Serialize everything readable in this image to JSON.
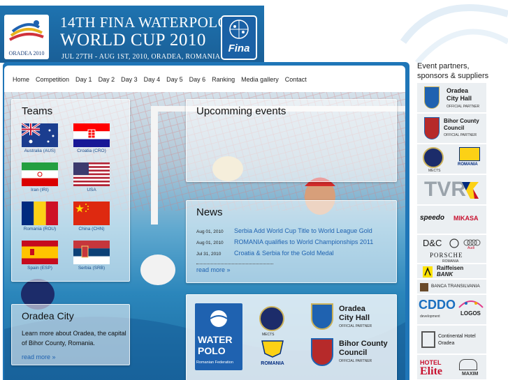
{
  "header": {
    "title_line1": "14TH FINA WATERPOLO",
    "title_line2": "WORLD CUP 2010",
    "title_line3": "JUL 27TH - AUG 1ST, 2010, ORADEA, ROMANIA",
    "host_logo_text": "ORADEA 2010",
    "fina_logo_text": "Fina"
  },
  "nav": {
    "items": [
      "Home",
      "Competition",
      "Day 1",
      "Day 2",
      "Day 3",
      "Day 4",
      "Day 5",
      "Day 6",
      "Ranking",
      "Media gallery",
      "Contact"
    ]
  },
  "teams": {
    "title": "Teams",
    "list": [
      {
        "label": "Australia (AUS)",
        "flag": "australia-flag"
      },
      {
        "label": "Croatia (CRO)",
        "flag": "croatia-flag"
      },
      {
        "label": "Iran (IRI)",
        "flag": "iran-flag"
      },
      {
        "label": "USA",
        "flag": "usa-flag"
      },
      {
        "label": "Romania (ROU)",
        "flag": "romania-flag"
      },
      {
        "label": "China (CHN)",
        "flag": "china-flag"
      },
      {
        "label": "Spain (ESP)",
        "flag": "spain-flag"
      },
      {
        "label": "Serbia (SRB)",
        "flag": "serbia-flag"
      }
    ]
  },
  "events": {
    "title": "Upcomming events"
  },
  "news": {
    "title": "News",
    "items": [
      {
        "date": "Aug 01, 2010",
        "title": "Serbia Add World Cup Title to World League Gold"
      },
      {
        "date": "Aug 01, 2010",
        "title": "ROMANIA qualifies to World Championships 2011"
      },
      {
        "date": "Jul 31, 2010",
        "title": "Croatia & Serbia for the Gold Medal"
      }
    ],
    "more": "read more »"
  },
  "oradea": {
    "title": "Oradea City",
    "text": "Learn more about Oradea, the capital of Bihor County, Romania.",
    "more": "read more »"
  },
  "partners_box": {
    "wp_line1": "WATER",
    "wp_line2": "POLO",
    "wp_sub": "Romanian Federation",
    "mects": "MECTS",
    "romania": "ROMANIA",
    "city_hall_line1": "Oradea",
    "city_hall_line2": "City Hall",
    "city_hall_sub": "OFFICIAL PARTNER",
    "county_line1": "Bihor County",
    "county_line2": "Council",
    "county_sub": "OFFICIAL PARTNER"
  },
  "sidebar": {
    "heading_line1": "Event partners,",
    "heading_line2": "sponsors & suppliers",
    "city_hall_line1": "Oradea",
    "city_hall_line2": "City Hall",
    "city_hall_sub": "OFFICIAL PARTNER",
    "county_line1": "Bihor County",
    "county_line2": "Council",
    "county_sub": "OFFICIAL PARTNER",
    "mects": "MECTS",
    "romania": "ROMANIA",
    "tvr": "TVR",
    "speedo": "speedo",
    "mikasa": "MIKASA",
    "dc": "D&C",
    "audi": "Audi",
    "porsche": "PORSCHE",
    "porsche_sub": "ROMANIA",
    "raiffeisen_line1": "Raiffeisen",
    "raiffeisen_line2": "BANK",
    "transilvania": "BANCA TRANSILVANIA",
    "cddo": "CDDO",
    "cddo_sub": "development",
    "logos": "LOGOS",
    "hotel_line1": "Continental Hotel",
    "hotel_line2": "Oradea",
    "elite_line1": "HOTEL",
    "elite_line2": "Elite",
    "maxim": "MAXIM"
  },
  "colors": {
    "frame_blue": "#1f76b8",
    "link_blue": "#1f62b0",
    "banner_blue": "#1e73b0"
  }
}
